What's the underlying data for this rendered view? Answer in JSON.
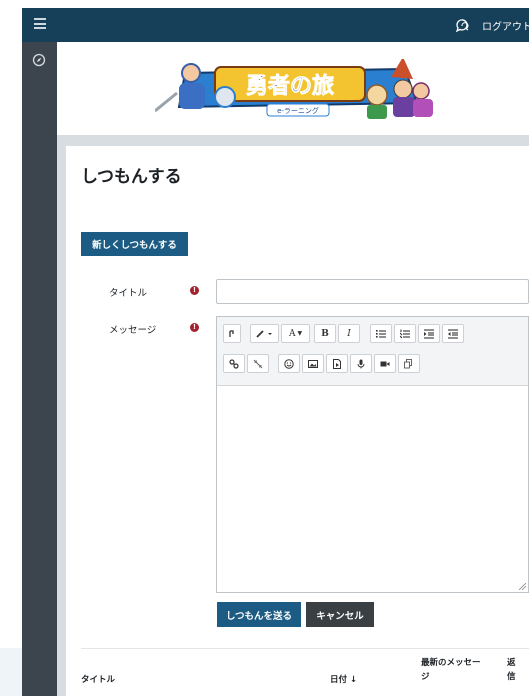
{
  "topbar": {
    "logout_label": "ログアウト"
  },
  "banner": {
    "logo_text": "勇者の旅",
    "logo_subtext": "e-ラーニング"
  },
  "page": {
    "title": "しつもんする"
  },
  "buttons": {
    "new_question": "新しくしつもんする",
    "send_question": "しつもんを送る",
    "cancel": "キャンセル"
  },
  "form": {
    "title_label": "タイトル",
    "message_label": "メッセージ",
    "required_mark": "!",
    "title_value": ""
  },
  "editor": {
    "row1": [
      "undo-icon",
      "paint-brush-icon",
      "font-size-icon",
      "bold-icon",
      "italic-icon",
      "unordered-list-icon",
      "ordered-list-icon",
      "indent-icon",
      "outdent-icon"
    ],
    "row2": [
      "link-icon",
      "unlink-icon",
      "emoji-icon",
      "image-icon",
      "media-icon",
      "microphone-icon",
      "video-icon",
      "copy-icon"
    ],
    "font_label": "A",
    "bold_label": "B",
    "italic_label": "I"
  },
  "table": {
    "headers": {
      "title": "タイトル",
      "date": "日付",
      "sort_arrow": "↓",
      "last_message_1": "最新のメッセー",
      "last_message_2": "ジ",
      "replies_1": "返",
      "replies_2": "信"
    }
  },
  "colors": {
    "topbar": "#163f5a",
    "sidebar": "#3c454e",
    "primary_button": "#1c5b83",
    "secondary_button": "#3a3f44",
    "required": "#a3222d"
  }
}
